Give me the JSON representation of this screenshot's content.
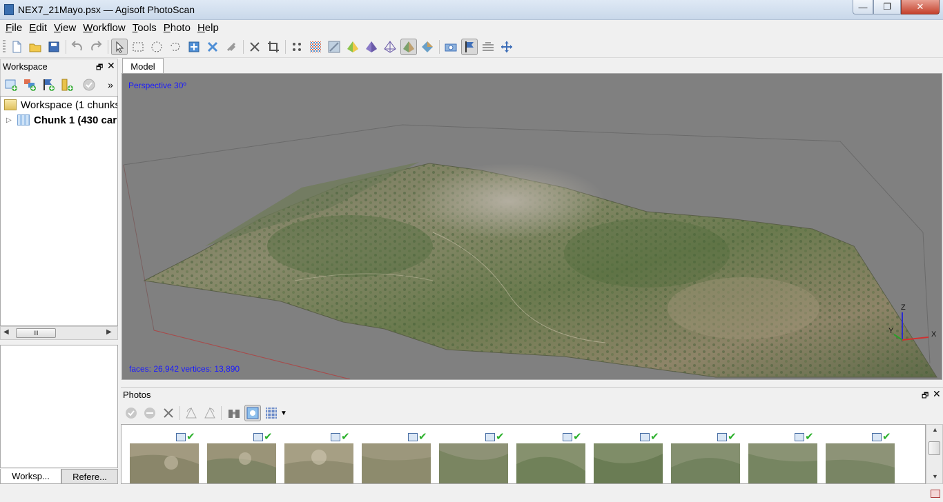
{
  "window": {
    "title": "NEX7_21Mayo.psx — Agisoft PhotoScan",
    "min_glyph": "—",
    "max_glyph": "❐",
    "close_glyph": "✕"
  },
  "menu": [
    "File",
    "Edit",
    "View",
    "Workflow",
    "Tools",
    "Photo",
    "Help"
  ],
  "toolbar": {
    "icons": [
      "new-icon",
      "open-icon",
      "save-icon",
      "undo-icon",
      "redo-icon",
      "navigation-icon",
      "rectangle-selection-icon",
      "circle-selection-icon",
      "free-form-selection-icon",
      "resize-region-icon",
      "rotate-region-icon",
      "rotate-object-icon",
      "delete-selection-icon",
      "crop-selection-icon",
      "point-cloud-icon",
      "dense-cloud-icon",
      "dense-cloud-classes-icon",
      "model-shaded-icon",
      "model-solid-icon",
      "model-wireframe-icon",
      "model-textured-icon",
      "tiled-model-icon",
      "show-cameras-icon",
      "show-markers-icon",
      "show-region-icon",
      "reset-view-icon"
    ]
  },
  "workspace": {
    "header": "Workspace",
    "float_glyph": "🗗",
    "close_glyph": "✕",
    "tools_more": "»",
    "tree": {
      "root": "Workspace (1 chunks",
      "chunk": "Chunk 1 (430 car"
    },
    "scroll_thumb": "III",
    "tabs": [
      "Worksp...",
      "Refere..."
    ]
  },
  "model": {
    "tab": "Model",
    "projection": "Perspective 30º",
    "stats": "faces: 26,942 vertices: 13,890",
    "axes": {
      "x": "X",
      "y": "Y",
      "z": "Z"
    },
    "colors": {
      "background": "#808080",
      "axis_x": "#d03030",
      "axis_y": "#2aa02a",
      "axis_z": "#2a2ad0",
      "label": "#1a1aff"
    }
  },
  "photos": {
    "header": "Photos",
    "float_glyph": "🗗",
    "close_glyph": "✕",
    "count_visible": 10,
    "items": [
      {
        "tone": "#a29a80"
      },
      {
        "tone": "#9a9478"
      },
      {
        "tone": "#a69f84"
      },
      {
        "tone": "#9c977c"
      },
      {
        "tone": "#8e9276"
      },
      {
        "tone": "#86916e"
      },
      {
        "tone": "#7f8d68"
      },
      {
        "tone": "#859070"
      },
      {
        "tone": "#8a9374"
      },
      {
        "tone": "#8d9377"
      }
    ]
  }
}
